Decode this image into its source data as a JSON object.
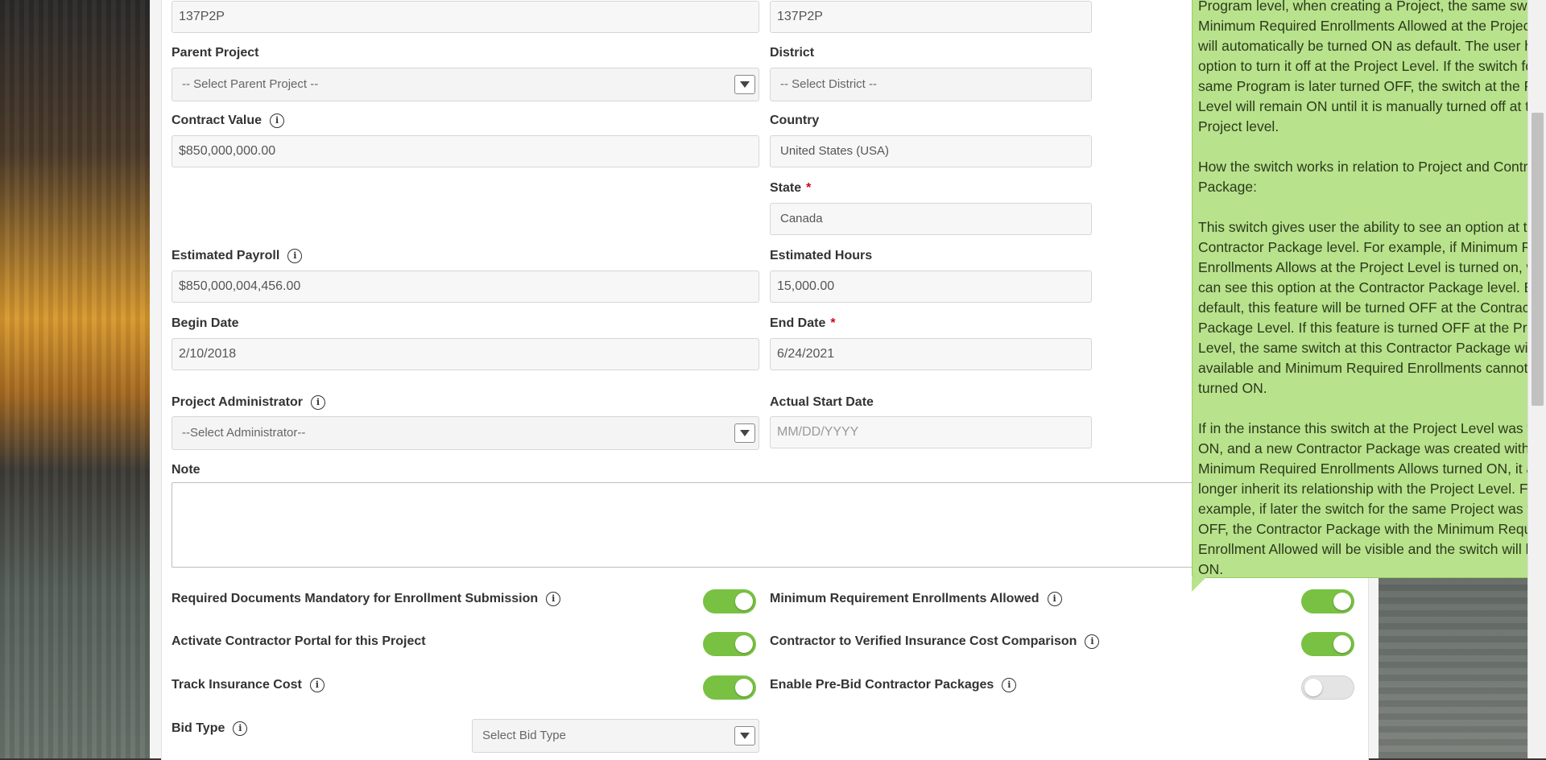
{
  "form": {
    "code_left": "137P2P",
    "code_right": "137P2P",
    "parent_project": {
      "label": "Parent Project",
      "placeholder": "-- Select Parent Project --"
    },
    "district": {
      "label": "District",
      "placeholder": "-- Select District --"
    },
    "contract_value": {
      "label": "Contract Value",
      "value": "$850,000,000.00"
    },
    "country": {
      "label": "Country",
      "value": "United States (USA)"
    },
    "state": {
      "label": "State",
      "required_mark": "*",
      "value": "Canada"
    },
    "estimated_payroll": {
      "label": "Estimated Payroll",
      "value": "$850,000,004,456.00"
    },
    "estimated_hours": {
      "label": "Estimated Hours",
      "value": "15,000.00"
    },
    "begin_date": {
      "label": "Begin Date",
      "value": "2/10/2018"
    },
    "end_date": {
      "label": "End Date",
      "required_mark": "*",
      "value": "6/24/2021"
    },
    "project_admin": {
      "label": "Project Administrator",
      "placeholder": "--Select Administrator--"
    },
    "actual_start_date": {
      "label": "Actual Start Date",
      "placeholder": "MM/DD/YYYY"
    },
    "note": {
      "label": "Note",
      "value": ""
    },
    "bid_type": {
      "label": "Bid Type",
      "placeholder": "Select Bid Type"
    }
  },
  "switches": {
    "required_docs": {
      "label": "Required Documents Mandatory for Enrollment Submission",
      "on": true
    },
    "min_enrollments": {
      "label": "Minimum Requirement Enrollments Allowed",
      "on": true
    },
    "contractor_portal": {
      "label": "Activate Contractor Portal for this Project",
      "on": true
    },
    "verified_insurance": {
      "label": "Contractor to Verified Insurance Cost Comparison",
      "on": true
    },
    "track_insurance": {
      "label": "Track Insurance Cost",
      "on": true
    },
    "pre_bid": {
      "label": "Enable Pre-Bid Contractor Packages",
      "on": false
    }
  },
  "info_icon_glyph": "i",
  "tooltip": {
    "paragraphs": [
      "Program level, when creating a Project, the same switch for Minimum Required Enrollments Allowed at the Project level will automatically be turned ON as default. The user has the option to turn it off at the Project Level. If the switch for that same Program is later turned OFF, the switch at the Project Level will remain ON until it is manually turned off at the Project level.",
      "How the switch works in relation to Project and Contractor Package:",
      "This switch gives user the ability to see an option at the Contractor Package level. For example, if Minimum Required Enrollments Allows at the Project Level is turned on, we now can see this option at the Contractor Package level. By default, this feature will be turned OFF at the Contractor Package Level. If this feature is turned OFF at the Project Level, the same switch at this Contractor Package will not be available and Minimum Required Enrollments cannot be turned ON.",
      "If in the instance this switch at the Project Level was turned ON, and a new Contractor Package was created with Minimum Required Enrollments Allows turned ON, it all no longer inherit its relationship with the Project Level. For example, if later the switch for the same Project was turned OFF, the Contractor Package with the Minimum Required Enrollment Allowed will be visible and the switch will be left ON."
    ]
  },
  "colors": {
    "toggle_on": "#79c142",
    "toggle_off": "#e4e4e4",
    "tooltip_bg": "#b9e28c",
    "required": "#d0021b"
  }
}
